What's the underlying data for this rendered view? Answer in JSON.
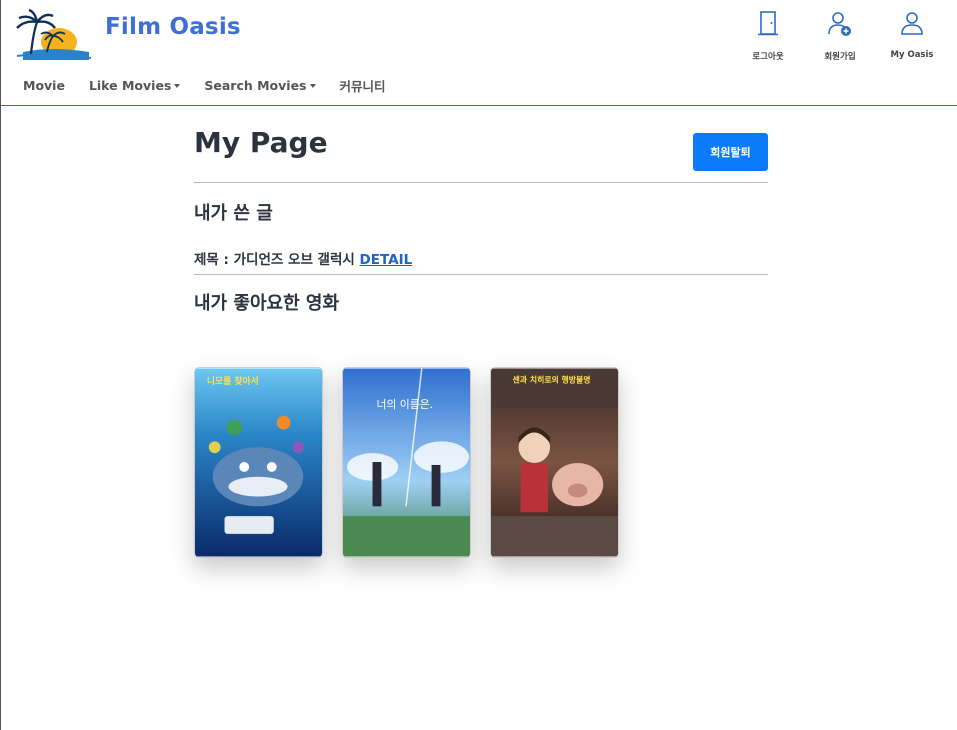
{
  "brand": {
    "name": "Film Oasis",
    "logo_icon": "palm-island-sunset-icon"
  },
  "nav": {
    "items": [
      {
        "label": "Movie",
        "dropdown": false
      },
      {
        "label": "Like Movies",
        "dropdown": true
      },
      {
        "label": "Search Movies",
        "dropdown": true
      },
      {
        "label": "커뮤니티",
        "dropdown": false
      }
    ]
  },
  "actions": [
    {
      "label": "로그아웃",
      "icon": "door-icon"
    },
    {
      "label": "회원가입",
      "icon": "user-add-icon"
    },
    {
      "label": "My Oasis",
      "icon": "user-icon"
    }
  ],
  "page": {
    "title": "My Page",
    "withdraw_label": "회원탈퇴",
    "my_posts_title": "내가 쓴 글",
    "post": {
      "prefix": "제목 : 가디언즈 오브 갤럭시",
      "link": "DETAIL"
    },
    "liked_movies_title": "내가 좋아요한 영화"
  },
  "liked_movies": [
    {
      "poster_text": "니모를 찾아서",
      "theme": "#1b5fa8"
    },
    {
      "poster_text": "너의 이름은.",
      "theme": "#4a8fd8"
    },
    {
      "poster_text": "센과 치히로의 행방불명",
      "theme": "#6a3d2e"
    }
  ],
  "colors": {
    "accent": "#0b7bfa",
    "brand": "#3d6fd6",
    "header_border": "#2f6bbd"
  }
}
